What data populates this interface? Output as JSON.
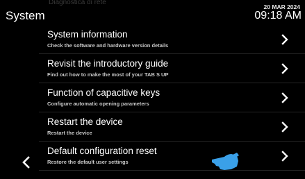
{
  "header": {
    "ghost_text": "Diagnostica di rete",
    "title": "System",
    "date": "20 MAR 2024",
    "time": "09:18 AM"
  },
  "items": [
    {
      "title": "System information",
      "subtitle": "Check the software and hardware version details"
    },
    {
      "title": "Revisit the introductory guide",
      "subtitle": "Find out how to make the most of your TAB S UP"
    },
    {
      "title": "Function of capacitive keys",
      "subtitle": "Configure automatic opening parameters"
    },
    {
      "title": "Restart the device",
      "subtitle": "Restart the device"
    },
    {
      "title": "Default configuration reset",
      "subtitle": "Restore the default user settings"
    }
  ],
  "icons": {
    "back": "chevron-left-icon",
    "next": "chevron-right-icon",
    "pointer": "hand-pointer-icon"
  },
  "colors": {
    "background": "#000000",
    "text": "#ffffff",
    "accent": "#3aa0e8"
  }
}
